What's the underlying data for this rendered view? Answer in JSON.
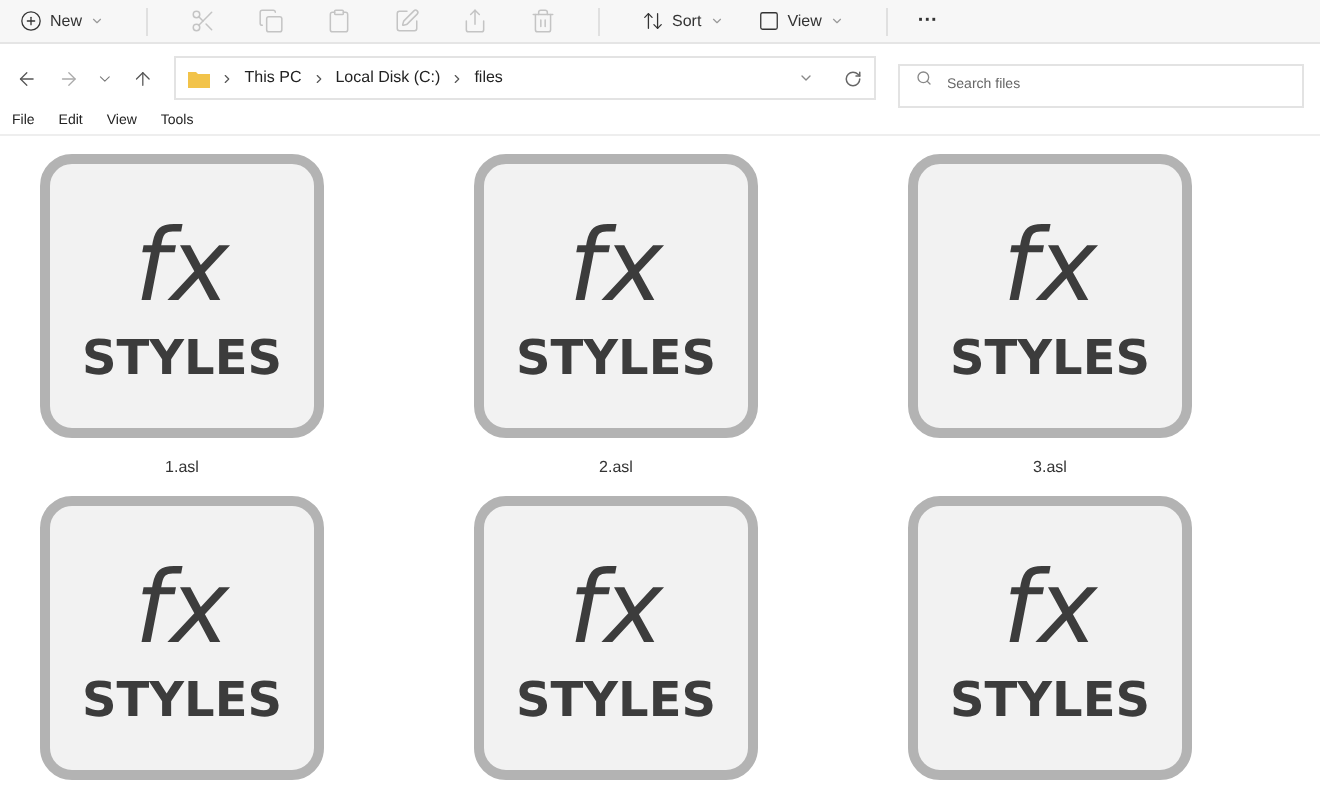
{
  "toolbar": {
    "new_label": "New",
    "sort_label": "Sort",
    "view_label": "View",
    "more_label": "···"
  },
  "address": {
    "crumbs": [
      "This PC",
      "Local Disk (C:)",
      "files"
    ]
  },
  "search": {
    "placeholder": "Search files"
  },
  "menu": [
    "File",
    "Edit",
    "View",
    "Tools"
  ],
  "files": [
    {
      "name": "1.asl",
      "icon_top": "fx",
      "icon_bottom": "STYLES"
    },
    {
      "name": "2.asl",
      "icon_top": "fx",
      "icon_bottom": "STYLES"
    },
    {
      "name": "3.asl",
      "icon_top": "fx",
      "icon_bottom": "STYLES"
    },
    {
      "icon_top": "fx",
      "icon_bottom": "STYLES"
    },
    {
      "icon_top": "fx",
      "icon_bottom": "STYLES"
    },
    {
      "icon_top": "fx",
      "icon_bottom": "STYLES"
    }
  ]
}
